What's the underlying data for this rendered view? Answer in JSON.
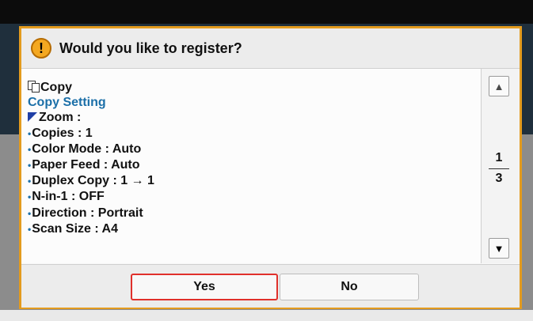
{
  "dialog": {
    "title": "Would you like to register?",
    "warning_glyph": "!",
    "lines": [
      {
        "text": "Copy",
        "kind": "head"
      },
      {
        "text": "Copy Setting",
        "kind": "subhead"
      },
      {
        "text": "Zoom :",
        "kind": "triangle"
      },
      {
        "text": "Copies : 1",
        "kind": "bullet"
      },
      {
        "text": "Color Mode : Auto",
        "kind": "bullet"
      },
      {
        "text": "Paper Feed : Auto",
        "kind": "bullet"
      },
      {
        "text": "Duplex Copy : 1 → 1",
        "kind": "bullet"
      },
      {
        "text": "N-in-1 : OFF",
        "kind": "bullet"
      },
      {
        "text": "Direction : Portrait",
        "kind": "bullet"
      },
      {
        "text": "Scan Size : A4",
        "kind": "bullet"
      }
    ],
    "bullet_glyph": "•",
    "page_current": "1",
    "page_total": "3",
    "scroll_up_glyph": "▲",
    "scroll_down_glyph": "▼",
    "buttons": {
      "yes": "Yes",
      "no": "No"
    },
    "colors": {
      "border": "#e39b1e",
      "subhead": "#1b6fa8",
      "yes_outline": "#e0302b",
      "warning": "#f4a821"
    }
  }
}
